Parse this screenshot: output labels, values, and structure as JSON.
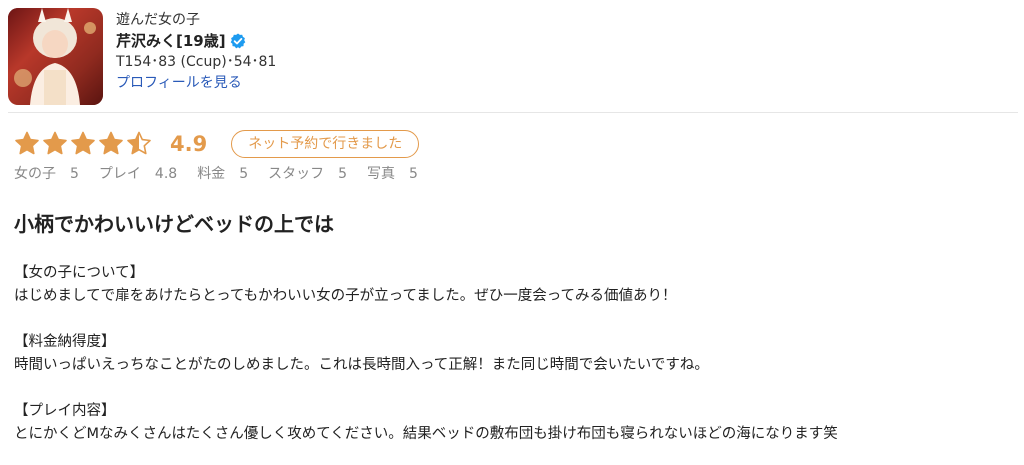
{
  "profile": {
    "label": "遊んだ女の子",
    "name": "芹沢みく[19歳]",
    "verified_icon": "verified-badge-icon",
    "specs": "T154･83 (Ccup)･54･81",
    "profile_link": "プロフィールを見る"
  },
  "rating": {
    "stars_filled": 4.5,
    "stars_total": 5,
    "value": "4.9",
    "badge": "ネット予約で行きました",
    "star_color": "#e39a4b"
  },
  "subscores": [
    {
      "label": "女の子",
      "value": "5"
    },
    {
      "label": "プレイ",
      "value": "4.8"
    },
    {
      "label": "料金",
      "value": "5"
    },
    {
      "label": "スタッフ",
      "value": "5"
    },
    {
      "label": "写真",
      "value": "5"
    }
  ],
  "review": {
    "title": "小柄でかわいいけどベッドの上では",
    "sections": [
      {
        "heading": "【女の子について】",
        "text": "はじめましてで扉をあけたらとってもかわいい女の子が立ってました。ぜひ一度会ってみる価値あり！"
      },
      {
        "heading": "【料金納得度】",
        "text": "時間いっぱいえっちなことがたのしめました。これは長時間入って正解！また同じ時間で会いたいですね。"
      },
      {
        "heading": "【プレイ内容】",
        "text": "とにかくどMなみくさんはたくさん優しく攻めてください。結果ベッドの敷布団も掛け布団も寝られないほどの海になります笑"
      }
    ]
  },
  "colors": {
    "accent": "#e39a4b",
    "link": "#2a5ab8",
    "verified": "#1d9bf0"
  }
}
